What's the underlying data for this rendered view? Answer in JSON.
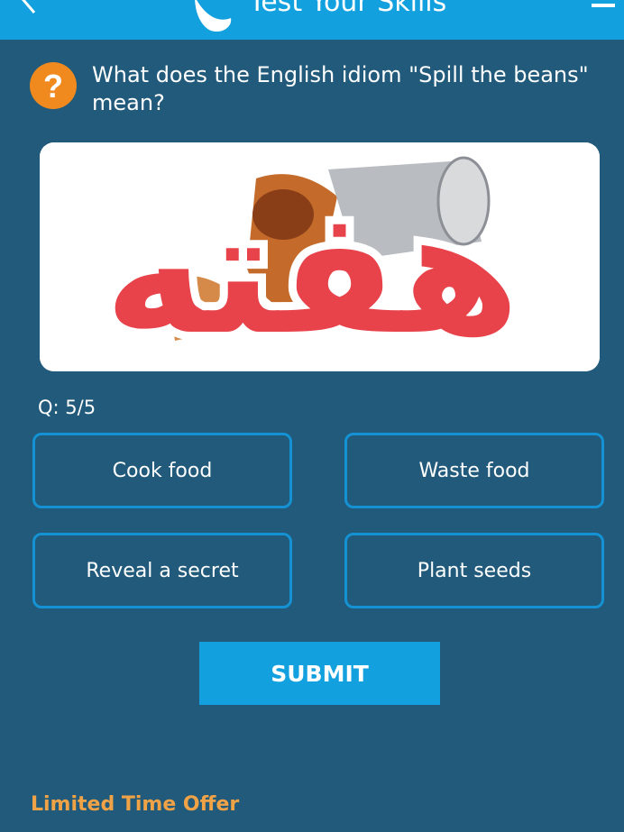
{
  "header": {
    "title": "Test Your Skills",
    "back_icon": "back-arrow-icon",
    "logo_icon": "brand-logo-icon",
    "menu_icon": "hamburger-menu-icon",
    "bar_color": "#12a0de"
  },
  "question": {
    "icon": "question-mark-icon",
    "text": "What does the English idiom \"Spill the beans\" mean?"
  },
  "image": {
    "watermark_text": "هفته"
  },
  "progress": {
    "label": "Q: 5/5"
  },
  "options": [
    {
      "label": "Cook food"
    },
    {
      "label": "Waste food"
    },
    {
      "label": "Reveal a secret"
    },
    {
      "label": "Plant seeds"
    }
  ],
  "submit_label": "SUBMIT",
  "offer_label": "Limited Time Offer",
  "colors": {
    "background": "#215a7a",
    "accent": "#12a0de",
    "option_border": "#1592d3",
    "offer": "#f0a246",
    "watermark": "#e8434b"
  }
}
